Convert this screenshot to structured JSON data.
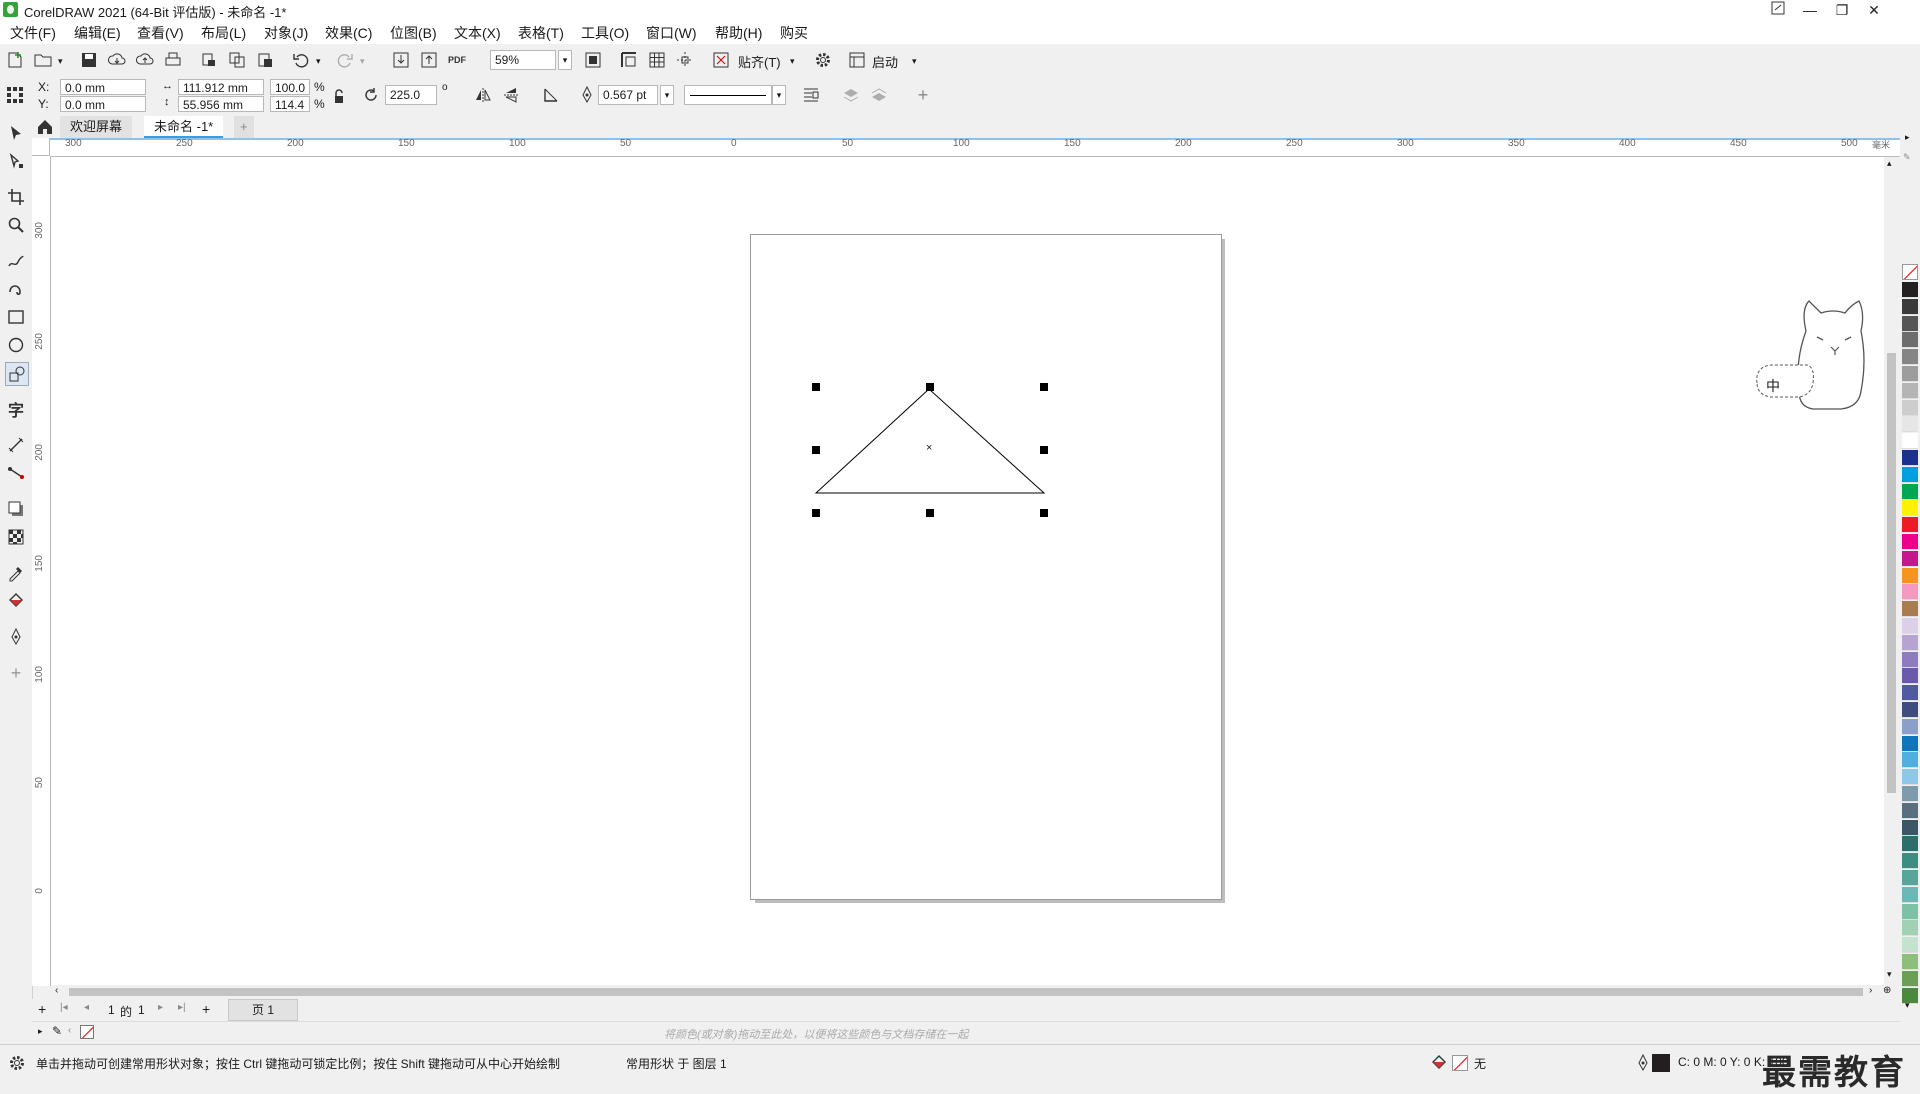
{
  "window": {
    "title": "CorelDRAW 2021 (64-Bit 评估版) - 未命名 -1*",
    "controls": {
      "minimize": "—",
      "restore": "❐",
      "close": "✕"
    }
  },
  "menu": [
    "文件(F)",
    "编辑(E)",
    "查看(V)",
    "布局(L)",
    "对象(J)",
    "效果(C)",
    "位图(B)",
    "文本(X)",
    "表格(T)",
    "工具(O)",
    "窗口(W)",
    "帮助(H)",
    "购买"
  ],
  "toolbar": {
    "zoom": "59%",
    "snap_label": "贴齐(T)",
    "launch_label": "启动"
  },
  "props": {
    "x_label": "X:",
    "x_value": "0.0 mm",
    "y_label": "Y:",
    "y_value": "0.0 mm",
    "width": "111.912 mm",
    "height": "55.956 mm",
    "scale_w": "100.0",
    "scale_h": "114.4",
    "percent": "%",
    "rotation": "225.0",
    "degree": "o",
    "outline_width": "0.567 pt"
  },
  "tabs": {
    "welcome": "欢迎屏幕",
    "document": "未命名 -1*",
    "add": "+"
  },
  "rulers": {
    "unit": "毫米",
    "h_ticks": [
      "300",
      "250",
      "200",
      "150",
      "100",
      "50",
      "0",
      "50",
      "100",
      "150",
      "200",
      "250",
      "300",
      "350",
      "400",
      "450",
      "500"
    ],
    "v_ticks": [
      "300",
      "250",
      "200",
      "150",
      "100",
      "50",
      "0"
    ]
  },
  "pages": {
    "current": "1",
    "of": "的",
    "total": "1",
    "page_tab": "页 1"
  },
  "docpalette_hint": "将颜色(或对象)拖动至此处，以便将这些颜色与文档存储在一起",
  "status": {
    "hint": "单击并拖动可创建常用形状对象；按住 Ctrl 键拖动可锁定比例；按住 Shift 键拖动可从中心开始绘制",
    "object_info": "常用形状 于 图层 1",
    "fill_label": "无",
    "cmyk": "C: 0 M: 0 Y: 0 K: 100"
  },
  "ime": {
    "mode": "中"
  },
  "watermark": "最需教育",
  "palette_colors": [
    "#231f20",
    "#3a3a3a",
    "#555555",
    "#6d6d6d",
    "#858585",
    "#9d9d9d",
    "#b5b5b5",
    "#cdcdcd",
    "#e6e6e6",
    "#ffffff",
    "#1b2f8e",
    "#00a0e0",
    "#00a651",
    "#fff200",
    "#ed1c24",
    "#ec008c",
    "#c6168d",
    "#f7941d",
    "#f49ac1",
    "#a97c50",
    "#dcd0e8",
    "#b6a3d1",
    "#8f7bbf",
    "#6a5aa8",
    "#505a9e",
    "#3f4d7e",
    "#8aa0c8",
    "#0f75bd",
    "#4fb0df",
    "#8fc7e6",
    "#7e9aad",
    "#5a6f7d",
    "#3b5664",
    "#2d6e6a",
    "#3b8f80",
    "#58a69a",
    "#6bb8b6",
    "#7ac2a3",
    "#9fd1b2",
    "#c4e3cf",
    "#8dbf7b",
    "#6aa055",
    "#4a8a3a"
  ]
}
